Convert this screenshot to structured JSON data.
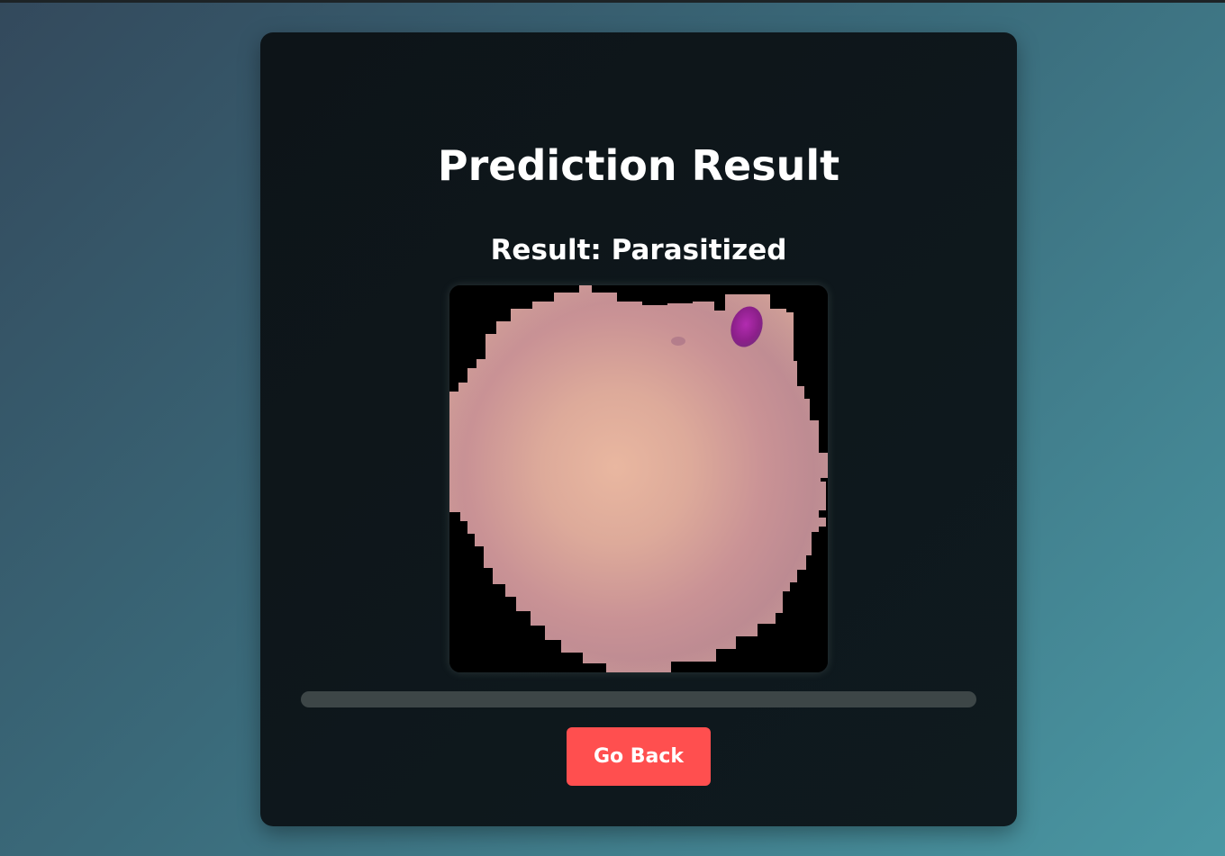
{
  "card": {
    "title": "Prediction Result",
    "result_text": "Result: Parasitized"
  },
  "image": {
    "alt": "Blood cell image",
    "depicts": "parasitized-red-blood-cell"
  },
  "progress": {
    "value": 0
  },
  "actions": {
    "go_back_label": "Go Back"
  },
  "colors": {
    "button": "#ff4f4f",
    "card_background": "#0f181d",
    "progress_track": "#3d4647",
    "page_gradient_start": "#33495c",
    "page_gradient_end": "#4a97a3"
  }
}
